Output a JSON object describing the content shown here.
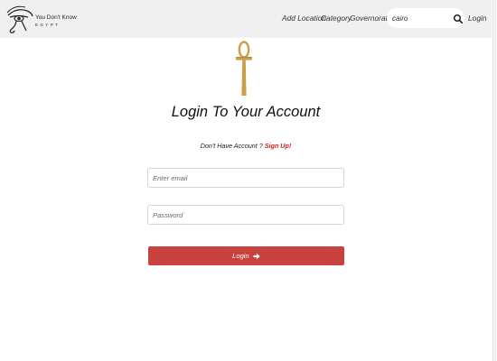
{
  "navbar": {
    "logo": {
      "line1": "You Don't Know",
      "line2": "EGYPT",
      "icon": "eye-of-horus-icon"
    },
    "links": {
      "add_location": "Add Location",
      "category": "Category",
      "governorates": "Governorates",
      "login": "Login"
    },
    "search": {
      "value": "cairo",
      "icon": "search-icon"
    }
  },
  "main": {
    "emblem_icon": "ankh-icon",
    "title": "Login To Your Account",
    "signup_prompt": "Don't Have Account ?",
    "signup_link": "Sign Up!",
    "email_placeholder": "Enter email",
    "password_placeholder": "Password",
    "login_button": "Login",
    "login_button_icon": "arrow-right-icon"
  },
  "colors": {
    "navbar_bg": "#f0f0f0",
    "accent_red": "#c9423f",
    "signup_red": "#d0201c",
    "ankh_gold": "#c9a04a"
  }
}
